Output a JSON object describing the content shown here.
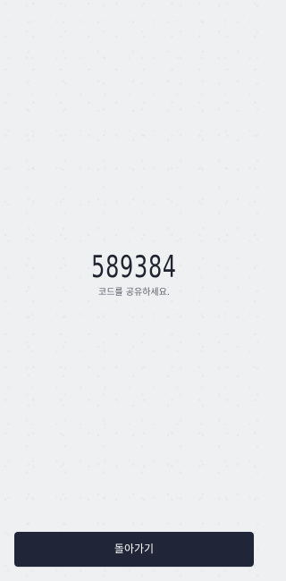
{
  "main": {
    "code": "589384",
    "instruction": "코드를 공유하세요."
  },
  "footer": {
    "back_label": "돌아가기"
  },
  "colors": {
    "background": "#eff0f2",
    "primary_text": "#202430",
    "secondary_text": "#5a5e67",
    "button_background": "#202638",
    "button_text": "#ffffff"
  }
}
